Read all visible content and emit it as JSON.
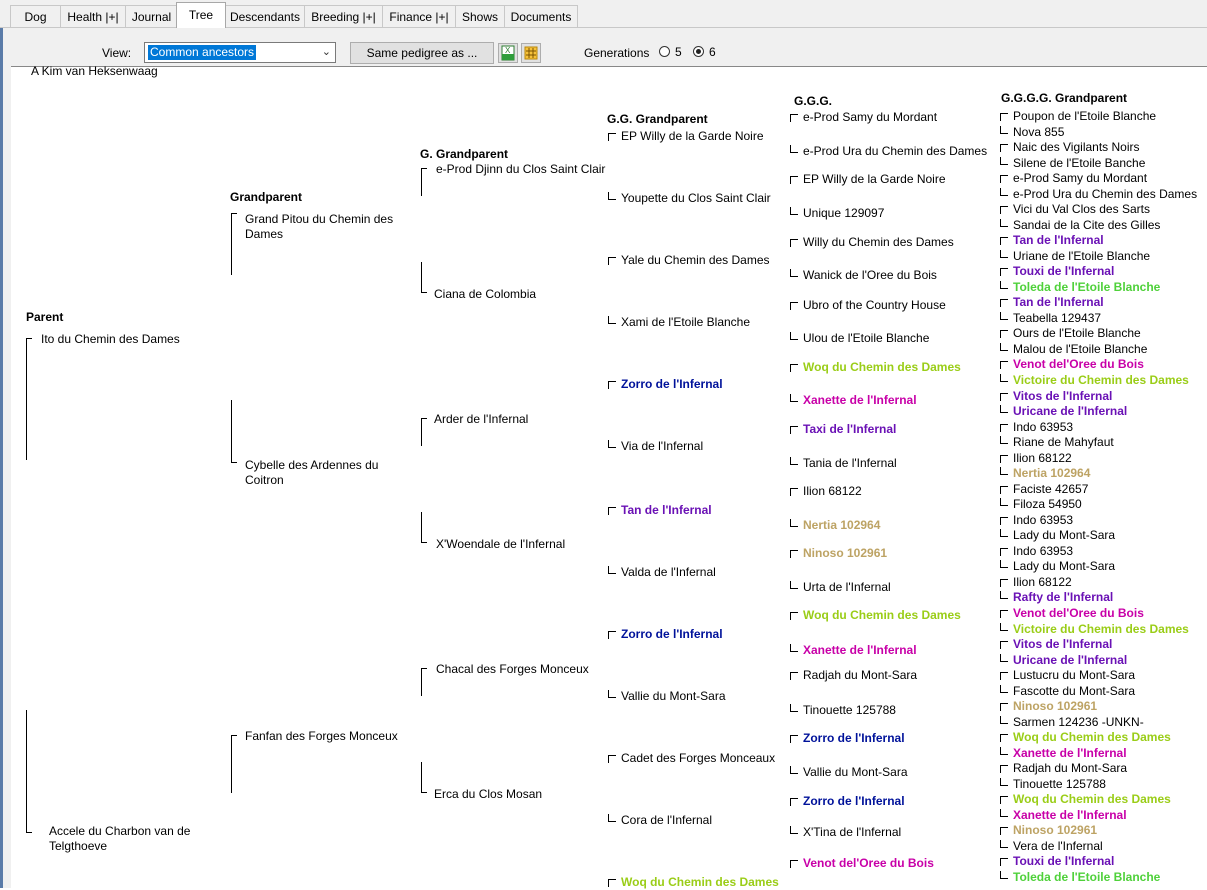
{
  "tabs": [
    {
      "label": "Dog",
      "active": false
    },
    {
      "label": "Health |+|",
      "active": false
    },
    {
      "label": "Journal",
      "active": false
    },
    {
      "label": "Tree",
      "active": true
    },
    {
      "label": "Descendants",
      "active": false
    },
    {
      "label": "Breeding |+|",
      "active": false
    },
    {
      "label": "Finance |+|",
      "active": false
    },
    {
      "label": "Shows",
      "active": false
    },
    {
      "label": "Documents",
      "active": false
    }
  ],
  "toolbar": {
    "view_label": "View:",
    "view_value": "Common ancestors",
    "same_pedigree_label": "Same pedigree as ...",
    "generations_label": "Generations",
    "gen5_label": "5",
    "gen6_label": "6",
    "generations_selected": "6"
  },
  "colors": {
    "blue": "#00129a",
    "purple": "#6a11b5",
    "magenta": "#c800a8",
    "yellowgreen": "#9acd17",
    "green": "#4fd13a",
    "tan": "#bda364"
  },
  "tree": {
    "subject": "A Kim van Heksenwaag",
    "headers": {
      "parent": "Parent",
      "grandparent": "Grandparent",
      "g_grandparent": "G. Grandparent",
      "gg_grandparent": "G.G. Grandparent",
      "ggg": "G.G.G.",
      "gggg": "G.G.G.G. Grandparent"
    },
    "parents": [
      "Ito du Chemin des Dames",
      "Accele du Charbon van de Telgthoeve"
    ],
    "grandparents": [
      "Grand Pitou du Chemin des Dames",
      "Cybelle des Ardennes du Coitron",
      "Fanfan des Forges Monceux"
    ],
    "g_grandparents": [
      "e-Prod Djinn du Clos Saint Clair",
      "Ciana de Colombia",
      "Arder de l'Infernal",
      "X'Woendale de l'Infernal",
      "Chacal des Forges Monceux",
      "Erca du Clos Mosan"
    ],
    "gg_grandparents": [
      {
        "name": "EP Willy de la Garde Noire",
        "color": ""
      },
      {
        "name": "Youpette du Clos Saint Clair",
        "color": ""
      },
      {
        "name": "Yale du Chemin des Dames",
        "color": ""
      },
      {
        "name": "Xami de l'Etoile Blanche",
        "color": ""
      },
      {
        "name": "Zorro de l'Infernal",
        "color": "blue"
      },
      {
        "name": "Via de l'Infernal",
        "color": ""
      },
      {
        "name": "Tan de l'Infernal",
        "color": "purple"
      },
      {
        "name": "Valda de l'Infernal",
        "color": ""
      },
      {
        "name": "Zorro de l'Infernal",
        "color": "blue"
      },
      {
        "name": "Vallie du Mont-Sara",
        "color": ""
      },
      {
        "name": "Cadet des Forges Monceaux",
        "color": ""
      },
      {
        "name": "Cora de l'Infernal",
        "color": ""
      },
      {
        "name": "Woq du Chemin des Dames",
        "color": "yellowgreen"
      }
    ],
    "ggg": [
      {
        "name": "e-Prod Samy du Mordant",
        "color": ""
      },
      {
        "name": "e-Prod Ura du Chemin des Dames",
        "color": ""
      },
      {
        "name": "EP Willy de la Garde Noire",
        "color": ""
      },
      {
        "name": "Unique  129097",
        "color": ""
      },
      {
        "name": "Willy du Chemin des Dames",
        "color": ""
      },
      {
        "name": "Wanick de l'Oree du Bois",
        "color": ""
      },
      {
        "name": "Ubro of the Country House",
        "color": ""
      },
      {
        "name": "Ulou de l'Etoile Blanche",
        "color": ""
      },
      {
        "name": "Woq du Chemin des Dames",
        "color": "yellowgreen"
      },
      {
        "name": "Xanette de l'Infernal",
        "color": "magenta"
      },
      {
        "name": "Taxi de l'Infernal",
        "color": "purple"
      },
      {
        "name": "Tania de l'Infernal",
        "color": ""
      },
      {
        "name": "Ilion  68122",
        "color": ""
      },
      {
        "name": "Nertia  102964",
        "color": "tan"
      },
      {
        "name": "Ninoso  102961",
        "color": "tan"
      },
      {
        "name": "Urta de l'Infernal",
        "color": ""
      },
      {
        "name": "Woq du Chemin des Dames",
        "color": "yellowgreen"
      },
      {
        "name": "Xanette de l'Infernal",
        "color": "magenta"
      },
      {
        "name": "Radjah du Mont-Sara",
        "color": ""
      },
      {
        "name": "Tinouette  125788",
        "color": ""
      },
      {
        "name": "Zorro de l'Infernal",
        "color": "blue"
      },
      {
        "name": "Vallie du Mont-Sara",
        "color": ""
      },
      {
        "name": "Zorro de l'Infernal",
        "color": "blue"
      },
      {
        "name": "X'Tina de l'Infernal",
        "color": ""
      },
      {
        "name": "Venot del'Oree du Bois",
        "color": "magenta"
      }
    ],
    "gggg": [
      {
        "name": "Poupon de l'Etoile Blanche",
        "color": ""
      },
      {
        "name": "Nova  855",
        "color": ""
      },
      {
        "name": "Naic des Vigilants Noirs",
        "color": ""
      },
      {
        "name": "Silene de l'Etoile Banche",
        "color": ""
      },
      {
        "name": "e-Prod Samy du Mordant",
        "color": ""
      },
      {
        "name": "e-Prod Ura du Chemin des Dames",
        "color": ""
      },
      {
        "name": "Vici du Val Clos des Sarts",
        "color": ""
      },
      {
        "name": "Sandai de la Cite des Gilles",
        "color": ""
      },
      {
        "name": "Tan de l'Infernal",
        "color": "purple"
      },
      {
        "name": "Uriane de l'Etoile Blanche",
        "color": ""
      },
      {
        "name": "Touxi de l'Infernal",
        "color": "purple"
      },
      {
        "name": "Toleda de l'Etoile Blanche",
        "color": "green"
      },
      {
        "name": "Tan de l'Infernal",
        "color": "purple"
      },
      {
        "name": "Teabella  129437",
        "color": ""
      },
      {
        "name": "Ours de l'Etoile Blanche",
        "color": ""
      },
      {
        "name": "Malou de l'Etoile Blanche",
        "color": ""
      },
      {
        "name": "Venot del'Oree du Bois",
        "color": "magenta"
      },
      {
        "name": "Victoire du Chemin des Dames",
        "color": "yellowgreen"
      },
      {
        "name": "Vitos de l'Infernal",
        "color": "purple"
      },
      {
        "name": "Uricane de l'Infernal",
        "color": "purple"
      },
      {
        "name": "Indo  63953",
        "color": ""
      },
      {
        "name": "Riane de Mahyfaut",
        "color": ""
      },
      {
        "name": "Ilion  68122",
        "color": ""
      },
      {
        "name": "Nertia  102964",
        "color": "tan"
      },
      {
        "name": "Faciste  42657",
        "color": ""
      },
      {
        "name": "Filoza  54950",
        "color": ""
      },
      {
        "name": "Indo  63953",
        "color": ""
      },
      {
        "name": "Lady du Mont-Sara",
        "color": ""
      },
      {
        "name": "Indo  63953",
        "color": ""
      },
      {
        "name": "Lady du Mont-Sara",
        "color": ""
      },
      {
        "name": "Ilion  68122",
        "color": ""
      },
      {
        "name": "Rafty de l'Infernal",
        "color": "purple"
      },
      {
        "name": "Venot del'Oree du Bois",
        "color": "magenta"
      },
      {
        "name": "Victoire du Chemin des Dames",
        "color": "yellowgreen"
      },
      {
        "name": "Vitos de l'Infernal",
        "color": "purple"
      },
      {
        "name": "Uricane de l'Infernal",
        "color": "purple"
      },
      {
        "name": "Lustucru du Mont-Sara",
        "color": ""
      },
      {
        "name": "Fascotte du Mont-Sara",
        "color": ""
      },
      {
        "name": "Ninoso  102961",
        "color": "tan"
      },
      {
        "name": "Sarmen  124236  -UNKN-",
        "color": ""
      },
      {
        "name": "Woq du Chemin des Dames",
        "color": "yellowgreen"
      },
      {
        "name": "Xanette de l'Infernal",
        "color": "magenta"
      },
      {
        "name": "Radjah du Mont-Sara",
        "color": ""
      },
      {
        "name": "Tinouette  125788",
        "color": ""
      },
      {
        "name": "Woq du Chemin des Dames",
        "color": "yellowgreen"
      },
      {
        "name": "Xanette de l'Infernal",
        "color": "magenta"
      },
      {
        "name": "Ninoso  102961",
        "color": "tan"
      },
      {
        "name": "Vera de l'Infernal",
        "color": ""
      },
      {
        "name": "Touxi de l'Infernal",
        "color": "purple"
      },
      {
        "name": "Toleda de l'Etoile Blanche",
        "color": "green"
      }
    ]
  }
}
